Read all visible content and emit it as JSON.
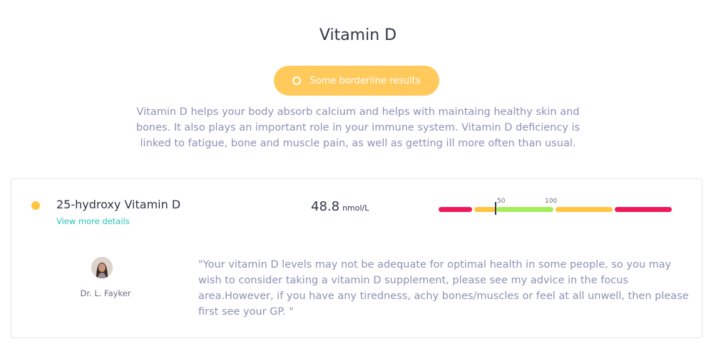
{
  "page": {
    "title": "Vitamin D",
    "status_label": "Some borderline results",
    "status_color": "#ffc95c",
    "description": "Vitamin D helps your body absorb calcium and helps with maintaing healthy skin and bones. It also plays an important role in your immune system. Vitamin D deficiency is linked to fatigue, bone and muscle pain, as well as getting ill more often than usual."
  },
  "marker": {
    "name": "25-hydroxy Vitamin D",
    "status_color": "#ffc440",
    "details_link": "View more details",
    "value": "48.8",
    "unit": "nmol/L",
    "range": {
      "tick_low": "50",
      "tick_high": "100",
      "colors": {
        "low": "#f0185a",
        "borderline": "#ffc440",
        "optimal": "#a3ee5a"
      }
    }
  },
  "doctor": {
    "name": "Dr. L. Fayker",
    "advice": "\"Your vitamin D levels may not be adequate for optimal health in some people, so you may wish to consider taking a vitamin D supplement, please see my advice in the focus area.However, if you have any tiredness, achy bones/muscles or feel at all unwell, then please first see your GP. \""
  }
}
